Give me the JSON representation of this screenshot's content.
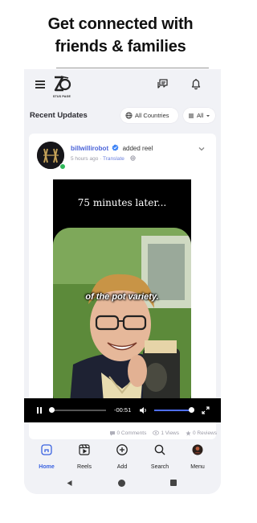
{
  "promo": {
    "line1": "Get connected with",
    "line2": "friends & families"
  },
  "app": {
    "logo_caption": "STUS PAGE"
  },
  "updates": {
    "title": "Recent Updates",
    "country_filter": "All Countries",
    "type_filter": "All"
  },
  "post": {
    "username": "billwillirobot",
    "action": "added reel",
    "time": "5 hours ago",
    "separator": " · ",
    "translate": "Translate",
    "video": {
      "caption_top": "75 minutes later...",
      "subtitle": "of the pot variety.",
      "time_remaining": "-00:51",
      "progress": 0.03,
      "volume": 1.0
    },
    "stats": {
      "comments": "0 Comments",
      "views": "1 Views",
      "reviews": "0 Reviews"
    }
  },
  "nav": {
    "home": "Home",
    "reels": "Reels",
    "add": "Add",
    "search": "Search",
    "menu": "Menu"
  },
  "colors": {
    "accent": "#3a62e0",
    "username": "#4a63d8",
    "online": "#2fb85a",
    "volume": "#4f6ef7"
  }
}
